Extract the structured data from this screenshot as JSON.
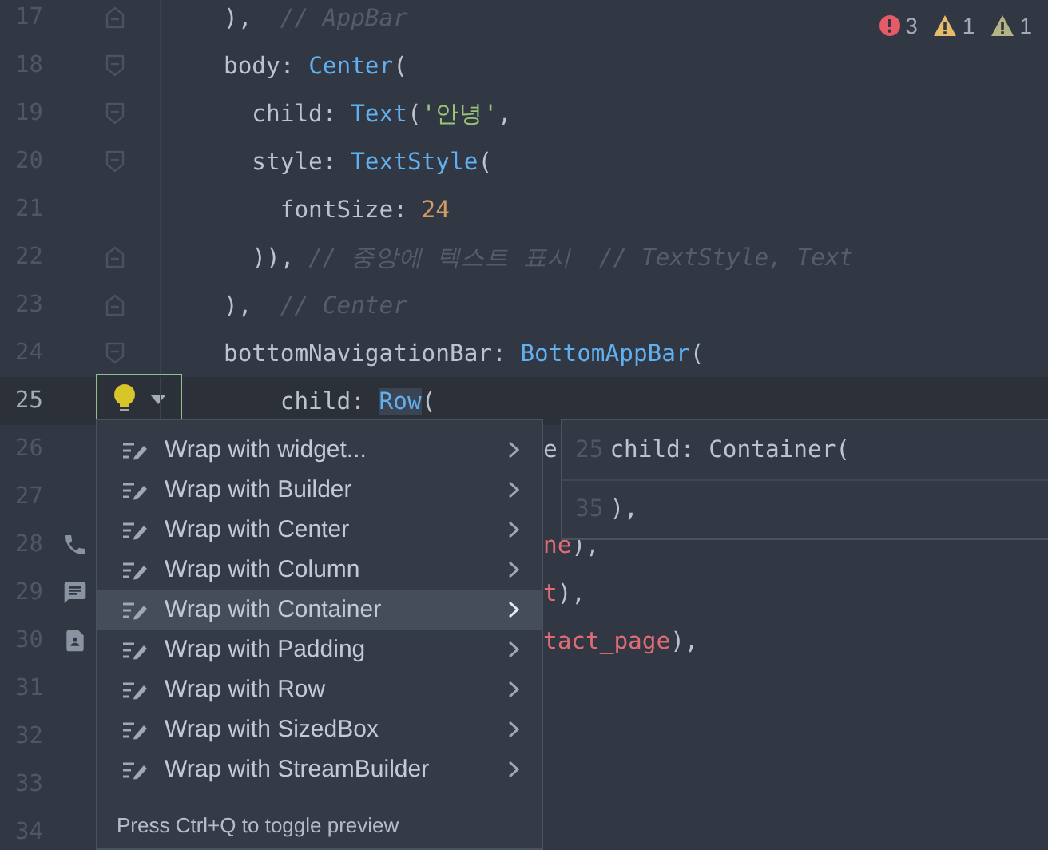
{
  "lines": [
    {
      "number": "17",
      "current": false,
      "kind": "fold_end",
      "clipped": false,
      "tokens": [
        {
          "kind": "plain",
          "text": "),  "
        },
        {
          "kind": "comment",
          "text": "// AppBar"
        }
      ]
    },
    {
      "number": "18",
      "current": false,
      "kind": "fold_start",
      "clipped": false,
      "tokens": [
        {
          "kind": "plain",
          "text": "body: "
        },
        {
          "kind": "type",
          "text": "Center"
        },
        {
          "kind": "plain",
          "text": "("
        }
      ]
    },
    {
      "number": "19",
      "current": false,
      "kind": "fold_start",
      "clipped": false,
      "tokens": [
        {
          "kind": "plain",
          "text": "  child: "
        },
        {
          "kind": "type",
          "text": "Text"
        },
        {
          "kind": "plain",
          "text": "("
        },
        {
          "kind": "string",
          "text": "'안녕'"
        },
        {
          "kind": "plain",
          "text": ","
        }
      ]
    },
    {
      "number": "20",
      "current": false,
      "kind": "fold_start",
      "clipped": false,
      "tokens": [
        {
          "kind": "plain",
          "text": "  style: "
        },
        {
          "kind": "type",
          "text": "TextStyle"
        },
        {
          "kind": "plain",
          "text": "("
        }
      ]
    },
    {
      "number": "21",
      "current": false,
      "kind": "code",
      "clipped": false,
      "tokens": [
        {
          "kind": "plain",
          "text": "    fontSize: "
        },
        {
          "kind": "number",
          "text": "24"
        }
      ]
    },
    {
      "number": "22",
      "current": false,
      "kind": "fold_end",
      "clipped": false,
      "tokens": [
        {
          "kind": "plain",
          "text": "  )), "
        },
        {
          "kind": "comment",
          "text": "// 중앙에 텍스트 표시  // TextStyle, Text"
        }
      ]
    },
    {
      "number": "23",
      "current": false,
      "kind": "fold_end",
      "clipped": false,
      "tokens": [
        {
          "kind": "plain",
          "text": "),  "
        },
        {
          "kind": "comment",
          "text": "// Center"
        }
      ]
    },
    {
      "number": "24",
      "current": false,
      "kind": "fold_start",
      "clipped": false,
      "tokens": [
        {
          "kind": "plain",
          "text": "bottomNavigationBar: "
        },
        {
          "kind": "type",
          "text": "BottomAppBar"
        },
        {
          "kind": "plain",
          "text": "("
        }
      ]
    },
    {
      "number": "25",
      "current": true,
      "clipped": false,
      "tokens": [
        {
          "kind": "plain",
          "text": "    child: "
        },
        {
          "kind": "match",
          "text": "Row"
        },
        {
          "kind": "plain",
          "text": "("
        }
      ]
    },
    {
      "number": "26",
      "current": false,
      "kind": "code",
      "clipped": true,
      "tokens": [
        {
          "kind": "plain",
          "text": "e"
        }
      ]
    },
    {
      "number": "27",
      "current": false,
      "kind": "code"
    },
    {
      "number": "28",
      "current": false,
      "kind": "code",
      "clipped": true,
      "gutter_icon": {
        "kind": "phone"
      },
      "tokens": [
        {
          "kind": "error",
          "text": "ne"
        },
        {
          "kind": "plain",
          "text": "),"
        }
      ]
    },
    {
      "number": "29",
      "current": false,
      "kind": "code",
      "clipped": true,
      "gutter_icon": {
        "kind": "message"
      },
      "tokens": [
        {
          "kind": "error",
          "text": "t"
        },
        {
          "kind": "plain",
          "text": "),"
        }
      ]
    },
    {
      "number": "30",
      "current": false,
      "kind": "code",
      "clipped": true,
      "gutter_icon": {
        "kind": "contact"
      },
      "tokens": [
        {
          "kind": "error",
          "text": "tact_page"
        },
        {
          "kind": "plain",
          "text": "),"
        }
      ]
    },
    {
      "number": "31",
      "current": false,
      "kind": "code"
    },
    {
      "number": "32",
      "current": false,
      "kind": "code"
    },
    {
      "number": "33",
      "current": false,
      "kind": "code"
    },
    {
      "number": "34",
      "current": false,
      "kind": "code"
    }
  ],
  "problems": [
    {
      "kind": "error",
      "count": "3"
    },
    {
      "kind": "warning",
      "count": "1"
    },
    {
      "kind": "weak_warning",
      "count": "1"
    }
  ],
  "menu": {
    "items": [
      {
        "label": "Wrap with widget...",
        "selected": false
      },
      {
        "label": "Wrap with Builder",
        "selected": false
      },
      {
        "label": "Wrap with Center",
        "selected": false
      },
      {
        "label": "Wrap with Column",
        "selected": false
      },
      {
        "label": "Wrap with Container",
        "selected": true
      },
      {
        "label": "Wrap with Padding",
        "selected": false
      },
      {
        "label": "Wrap with Row",
        "selected": false
      },
      {
        "label": "Wrap with SizedBox",
        "selected": false
      },
      {
        "label": "Wrap with StreamBuilder",
        "selected": false
      }
    ],
    "footer": "Press Ctrl+Q to toggle preview"
  },
  "preview": {
    "lines": [
      {
        "number": "25",
        "code": "child: Container("
      },
      {
        "number": "35",
        "code": "),"
      }
    ]
  }
}
